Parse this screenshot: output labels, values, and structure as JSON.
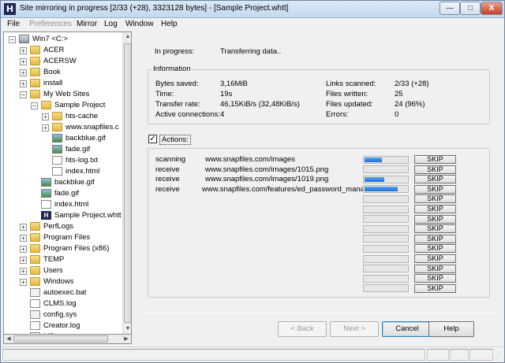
{
  "window": {
    "title": "Site mirroring in progress [2/33 (+28), 3323128 bytes] - [Sample Project.whtt]",
    "app_icon_letter": "H",
    "minimize": "—",
    "maximize": "□",
    "close": "X"
  },
  "menu": [
    "File",
    "Preferences",
    "Mirror",
    "Log",
    "Window",
    "Help"
  ],
  "tree": [
    {
      "label": "Win7 <C:>",
      "icon": "drive-icon",
      "level": 0,
      "expander": "−"
    },
    {
      "label": "ACER",
      "icon": "folder-icon",
      "level": 1,
      "expander": "+"
    },
    {
      "label": "ACERSW",
      "icon": "folder-icon",
      "level": 1,
      "expander": "+"
    },
    {
      "label": "Book",
      "icon": "folder-icon",
      "level": 1,
      "expander": "+"
    },
    {
      "label": "install",
      "icon": "folder-icon",
      "level": 1,
      "expander": "+"
    },
    {
      "label": "My Web Sites",
      "icon": "folder-icon",
      "level": 1,
      "expander": "−"
    },
    {
      "label": "Sample Project",
      "icon": "folder-icon",
      "level": 2,
      "expander": "−"
    },
    {
      "label": "hts-cache",
      "icon": "folder-icon",
      "level": 3,
      "expander": "+"
    },
    {
      "label": "www.snapfiles.c",
      "icon": "folder-icon",
      "level": 3,
      "expander": "+"
    },
    {
      "label": "backblue.gif",
      "icon": "gif-icon",
      "level": 3,
      "expander": ""
    },
    {
      "label": "fade.gif",
      "icon": "gif-icon",
      "level": 3,
      "expander": ""
    },
    {
      "label": "hts-log.txt",
      "icon": "text-file-icon",
      "level": 3,
      "expander": ""
    },
    {
      "label": "index.html",
      "icon": "html-file-icon",
      "level": 3,
      "expander": ""
    },
    {
      "label": "backblue.gif",
      "icon": "gif-icon",
      "level": 2,
      "expander": ""
    },
    {
      "label": "fade.gif",
      "icon": "gif-icon",
      "level": 2,
      "expander": ""
    },
    {
      "label": "index.html",
      "icon": "html-file-icon",
      "level": 2,
      "expander": ""
    },
    {
      "label": "Sample Project.whtt",
      "icon": "whtt-file-icon",
      "level": 2,
      "expander": ""
    },
    {
      "label": "PerfLogs",
      "icon": "folder-icon",
      "level": 1,
      "expander": "+"
    },
    {
      "label": "Program Files",
      "icon": "folder-icon",
      "level": 1,
      "expander": "+"
    },
    {
      "label": "Program Files (x86)",
      "icon": "folder-icon",
      "level": 1,
      "expander": "+"
    },
    {
      "label": "TEMP",
      "icon": "folder-icon",
      "level": 1,
      "expander": "+"
    },
    {
      "label": "Users",
      "icon": "folder-icon",
      "level": 1,
      "expander": "+"
    },
    {
      "label": "Windows",
      "icon": "folder-icon",
      "level": 1,
      "expander": "+"
    },
    {
      "label": "autoexec.bat",
      "icon": "bat-file-icon",
      "level": 1,
      "expander": ""
    },
    {
      "label": "CLMS.log",
      "icon": "text-file-icon",
      "level": 1,
      "expander": ""
    },
    {
      "label": "config.sys",
      "icon": "bat-file-icon",
      "level": 1,
      "expander": ""
    },
    {
      "label": "Creator.log",
      "icon": "text-file-icon",
      "level": 1,
      "expander": ""
    },
    {
      "label": "MP...",
      "icon": "text-file-icon",
      "level": 1,
      "expander": ""
    }
  ],
  "status": {
    "in_progress_label": "In progress:",
    "in_progress_value": "Transferring data.."
  },
  "info": {
    "title": "Information",
    "left": [
      {
        "label": "Bytes saved:",
        "value": "3,16MiB"
      },
      {
        "label": "Time:",
        "value": "19s"
      },
      {
        "label": "Transfer rate:",
        "value": "46,15KiB/s (32,48KiB/s)"
      },
      {
        "label": "Active connections:",
        "value": "4"
      }
    ],
    "right": [
      {
        "label": "Links scanned:",
        "value": "2/33 (+28)"
      },
      {
        "label": "Files written:",
        "value": "25"
      },
      {
        "label": "Files updated:",
        "value": "24 (96%)"
      },
      {
        "label": "Errors:",
        "value": "0"
      }
    ]
  },
  "actions": {
    "checkbox_mark": "✓",
    "label": "Actions:",
    "skip_label": "SKIP",
    "rows": [
      {
        "action": "scanning",
        "url": "www.snapfiles.com/images",
        "progress": 0.4
      },
      {
        "action": "receive",
        "url": "www.snapfiles.com/images/1015.png",
        "progress": 0.0
      },
      {
        "action": "receive",
        "url": "www.snapfiles.com/images/1019.png",
        "progress": 0.45
      },
      {
        "action": "receive",
        "url": "www.snapfiles.com/features/ed_password_managers",
        "progress": 0.75
      },
      {
        "action": "",
        "url": "",
        "progress": 0
      },
      {
        "action": "",
        "url": "",
        "progress": 0
      },
      {
        "action": "",
        "url": "",
        "progress": 0
      },
      {
        "action": "",
        "url": "",
        "progress": 0
      },
      {
        "action": "",
        "url": "",
        "progress": 0
      },
      {
        "action": "",
        "url": "",
        "progress": 0
      },
      {
        "action": "",
        "url": "",
        "progress": 0
      },
      {
        "action": "",
        "url": "",
        "progress": 0
      },
      {
        "action": "",
        "url": "",
        "progress": 0
      },
      {
        "action": "",
        "url": "",
        "progress": 0
      }
    ]
  },
  "buttons": {
    "back": "< Back",
    "next": "Next >",
    "cancel": "Cancel",
    "help": "Help"
  }
}
